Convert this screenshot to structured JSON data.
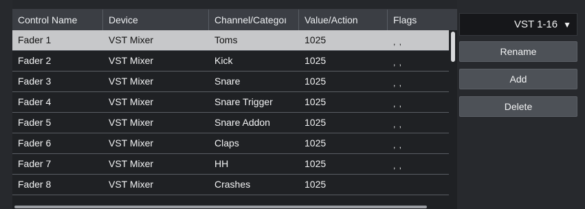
{
  "table": {
    "columns": [
      "Control Name",
      "Device",
      "Channel/Categoı",
      "Value/Action",
      "Flags"
    ],
    "rows": [
      {
        "name": "Fader 1",
        "device": "VST Mixer",
        "channel": "Toms",
        "value": "1025",
        "flags": ", ,",
        "selected": true
      },
      {
        "name": "Fader 2",
        "device": "VST Mixer",
        "channel": "Kick",
        "value": "1025",
        "flags": ", ,"
      },
      {
        "name": "Fader 3",
        "device": "VST Mixer",
        "channel": "Snare",
        "value": "1025",
        "flags": ", ,"
      },
      {
        "name": "Fader 4",
        "device": "VST Mixer",
        "channel": "Snare Trigger",
        "value": "1025",
        "flags": ", ,"
      },
      {
        "name": "Fader 5",
        "device": "VST Mixer",
        "channel": "Snare Addon",
        "value": "1025",
        "flags": ", ,"
      },
      {
        "name": "Fader 6",
        "device": "VST Mixer",
        "channel": "Claps",
        "value": "1025",
        "flags": ", ,"
      },
      {
        "name": "Fader 7",
        "device": "VST Mixer",
        "channel": "HH",
        "value": "1025",
        "flags": ", ,"
      },
      {
        "name": "Fader 8",
        "device": "VST Mixer",
        "channel": "Crashes",
        "value": "1025",
        "flags": ""
      }
    ]
  },
  "side": {
    "preset": "VST 1-16",
    "chevron_icon": "triangle-down-icon",
    "rename_label": "Rename",
    "add_label": "Add",
    "delete_label": "Delete"
  }
}
